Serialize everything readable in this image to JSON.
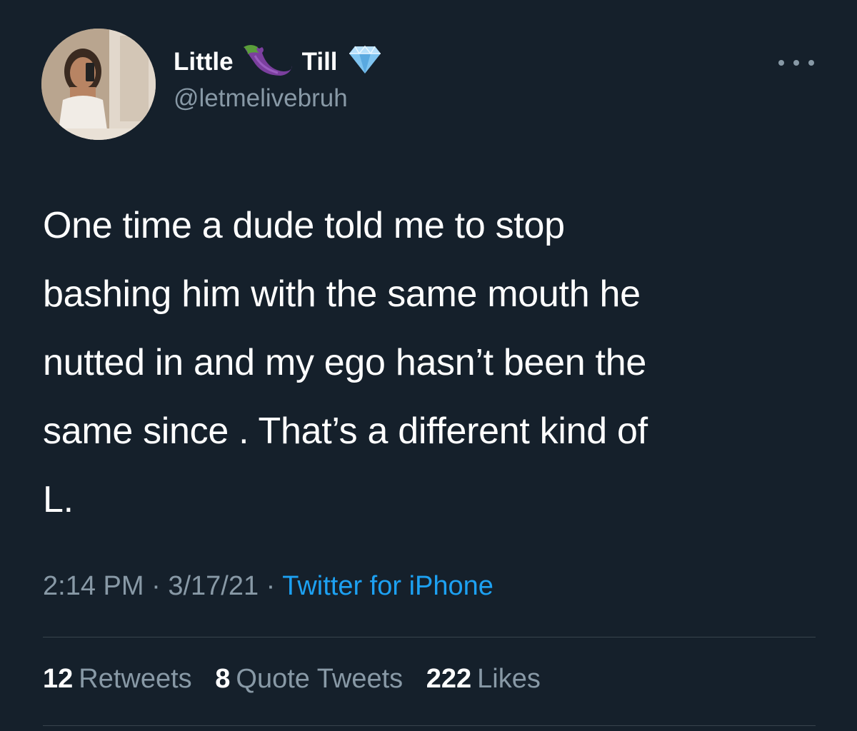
{
  "author": {
    "name_part_1": "Little",
    "name_emoji": "eggplant-emoji",
    "name_part_2": "Till",
    "verified_badge": "diamond-emoji",
    "handle": "@letmelivebruh"
  },
  "tweet": {
    "text_lines": [
      "One time a dude told me to stop",
      "bashing him with the same mouth he",
      "nutted in and my ego hasn’t been the",
      "same since . That’s a different kind of",
      "L."
    ]
  },
  "meta": {
    "time": "2:14 PM",
    "separator": " · ",
    "date": "3/17/21",
    "source": "Twitter for iPhone"
  },
  "stats": {
    "retweets_count": "12",
    "retweets_label": "Retweets",
    "quotes_count": "8",
    "quotes_label": "Quote Tweets",
    "likes_count": "222",
    "likes_label": "Likes"
  },
  "colors": {
    "background": "#15202b",
    "primary_text": "#ffffff",
    "secondary_text": "#8899a6",
    "link": "#1da1f2",
    "divider": "#38444d"
  }
}
